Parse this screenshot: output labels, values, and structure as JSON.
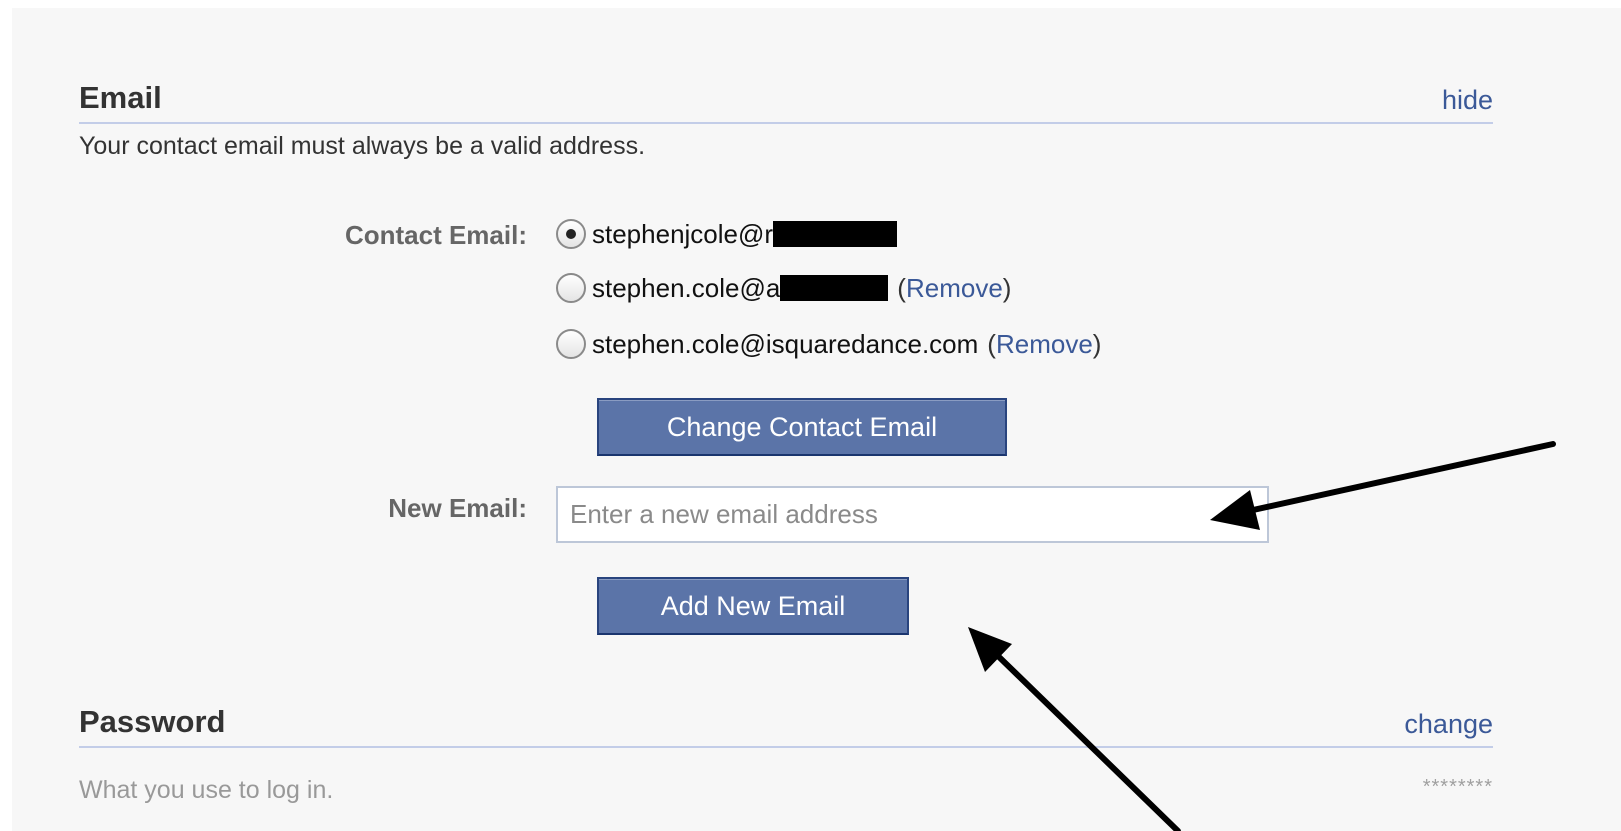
{
  "email_section": {
    "title": "Email",
    "action": "hide",
    "description": "Your contact email must always be a valid address.",
    "contact_label": "Contact Email:",
    "emails": [
      {
        "prefix": "stephenjcole@r",
        "selected": true,
        "removable": false
      },
      {
        "prefix": "stephen.cole@a",
        "selected": false,
        "removable": true
      },
      {
        "prefix": "stephen.cole@isquaredance.com",
        "selected": false,
        "removable": true
      }
    ],
    "remove_label": "Remove",
    "remove_paren_open": "(",
    "remove_paren_close": ")",
    "change_button": "Change Contact Email",
    "new_email_label": "New Email:",
    "new_email_placeholder": "Enter a new email address",
    "new_email_value": "",
    "add_button": "Add New Email"
  },
  "password_section": {
    "title": "Password",
    "action": "change",
    "description": "What you use to log in.",
    "masked_value": "********"
  },
  "colors": {
    "link": "#3b5998",
    "button_bg": "#5b74a8",
    "button_border": "#29447e",
    "rule": "#c3cde8",
    "panel_bg": "#f7f7f7",
    "annotation_arrow": "#000000"
  },
  "icons": [
    "radio-selected-icon",
    "radio-unselected-icon",
    "annotation-arrow-icon"
  ]
}
